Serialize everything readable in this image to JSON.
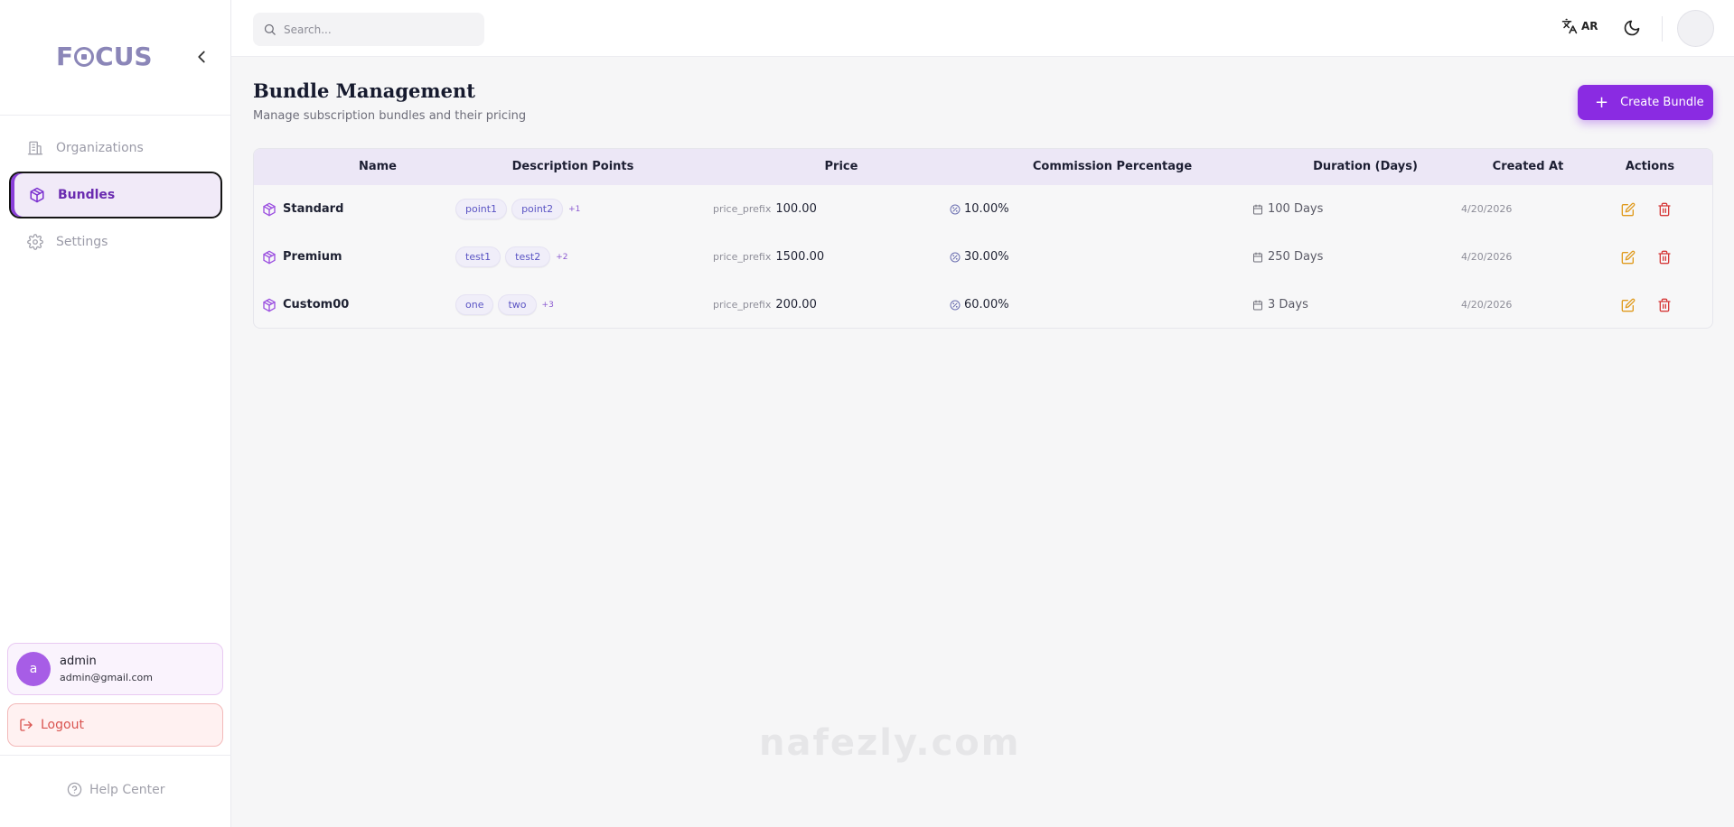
{
  "brand": {
    "logo_text_left": "F",
    "logo_text_right": "CUS",
    "accent": "#8a2be2"
  },
  "sidebar": {
    "items": [
      {
        "label": "Organizations",
        "icon": "building-icon",
        "active": false
      },
      {
        "label": "Bundles",
        "icon": "cube-icon",
        "active": true
      },
      {
        "label": "Settings",
        "icon": "gear-icon",
        "active": false
      }
    ],
    "user": {
      "initial": "a",
      "name": "admin",
      "email": "admin@gmail.com"
    },
    "logout_label": "Logout",
    "help_label": "Help Center"
  },
  "topbar": {
    "search_placeholder": "Search...",
    "language_label": "AR"
  },
  "main": {
    "title": "Bundle Management",
    "subtitle": "Manage subscription bundles and their pricing",
    "create_label": "Create Bundle"
  },
  "table": {
    "headers": [
      "Name",
      "Description Points",
      "Price",
      "Commission Percentage",
      "Duration (Days)",
      "Created At",
      "Actions"
    ],
    "rows": [
      {
        "name": "Standard",
        "points": [
          "point1",
          "point2"
        ],
        "more": "+1",
        "price_prefix": "price_prefix",
        "price": "100.00",
        "commission": "10.00%",
        "duration": "100 Days",
        "created": "4/20/2026"
      },
      {
        "name": "Premium",
        "points": [
          "test1",
          "test2"
        ],
        "more": "+2",
        "price_prefix": "price_prefix",
        "price": "1500.00",
        "commission": "30.00%",
        "duration": "250 Days",
        "created": "4/20/2026"
      },
      {
        "name": "Custom00",
        "points": [
          "one",
          "two"
        ],
        "more": "+3",
        "price_prefix": "price_prefix",
        "price": "200.00",
        "commission": "60.00%",
        "duration": "3 Days",
        "created": "4/20/2026"
      }
    ]
  },
  "watermark_text": "nafezly.com"
}
